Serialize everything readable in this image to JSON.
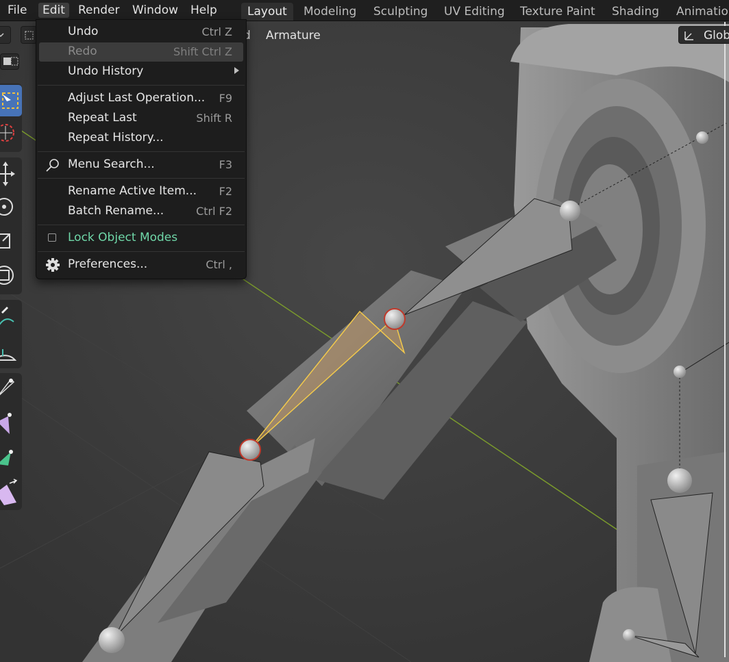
{
  "menubar": {
    "items": [
      "File",
      "Edit",
      "Render",
      "Window",
      "Help"
    ],
    "active": "Edit"
  },
  "workspaces": {
    "tabs": [
      "Layout",
      "Modeling",
      "Sculpting",
      "UV Editing",
      "Texture Paint",
      "Shading",
      "Animatio"
    ],
    "active": "Layout"
  },
  "viewport_header": {
    "partial_label": "d",
    "armature_label": "Armature",
    "orientation_label": "Glob"
  },
  "edit_menu": {
    "items": [
      {
        "label": "Undo",
        "shortcut": "Ctrl Z",
        "state": "enabled"
      },
      {
        "label": "Redo",
        "shortcut": "Shift Ctrl Z",
        "state": "disabled"
      },
      {
        "label": "Undo History",
        "shortcut": "",
        "state": "submenu"
      },
      {
        "label": "Adjust Last Operation...",
        "shortcut": "F9",
        "state": "enabled"
      },
      {
        "label": "Repeat Last",
        "shortcut": "Shift R",
        "state": "enabled"
      },
      {
        "label": "Repeat History...",
        "shortcut": "",
        "state": "enabled"
      },
      {
        "label": "Menu Search...",
        "shortcut": "F3",
        "state": "enabled",
        "icon": "search-icon"
      },
      {
        "label": "Rename Active Item...",
        "shortcut": "F2",
        "state": "enabled"
      },
      {
        "label": "Batch Rename...",
        "shortcut": "Ctrl F2",
        "state": "enabled"
      },
      {
        "label": "Lock Object Modes",
        "shortcut": "",
        "state": "checkbox",
        "checked": false
      },
      {
        "label": "Preferences...",
        "shortcut": "Ctrl ,",
        "state": "enabled",
        "icon": "gear-icon"
      }
    ]
  },
  "toolbar": {
    "tools": [
      "select-box-icon",
      "cursor-icon",
      "move-icon",
      "rotate-icon",
      "scale-icon",
      "transform-icon",
      "annotate-icon",
      "measure-icon",
      "bone-roll-icon",
      "bone-size-icon",
      "extrude-icon",
      "extrude-cursor-icon"
    ],
    "active": "select-box-icon"
  },
  "colors": {
    "accent_active": "#4773b8",
    "selected_bone": "#f2c94c",
    "green_text": "#6fd7a8",
    "grid_axis": "#7a9a2c"
  }
}
